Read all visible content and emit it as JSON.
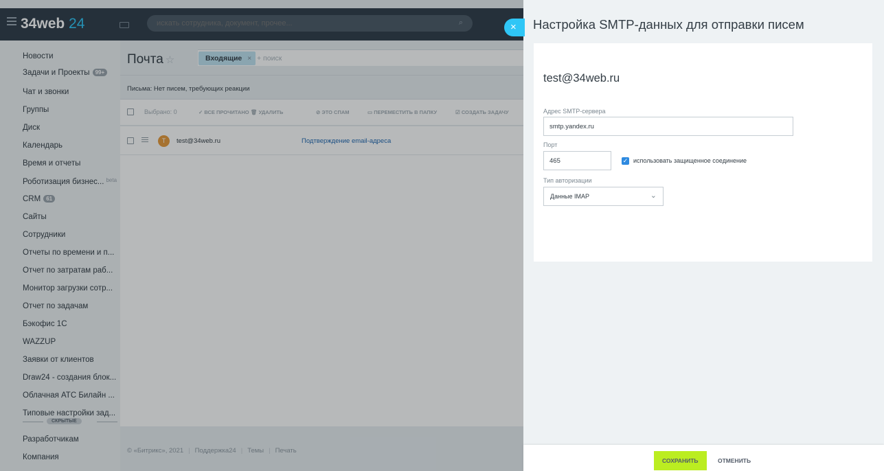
{
  "portal": {
    "logo_text": "34web",
    "logo_number": "24",
    "search_placeholder": "искать сотрудника, документ, прочее..."
  },
  "menu": {
    "items": [
      {
        "label": "Новости"
      },
      {
        "label": "Задачи и Проекты",
        "badge": "99+"
      },
      {
        "label": "Чат и звонки"
      },
      {
        "label": "Группы"
      },
      {
        "label": "Диск"
      },
      {
        "label": "Календарь"
      },
      {
        "label": "Время и отчеты"
      },
      {
        "label": "Роботизация бизнес...",
        "tag": "beta"
      },
      {
        "label": "CRM",
        "badge": "61"
      },
      {
        "label": "Сайты"
      },
      {
        "label": "Сотрудники"
      },
      {
        "label": "Отчеты по времени и п..."
      },
      {
        "label": "Отчет по затратам раб..."
      },
      {
        "label": "Монитор загрузки сотр..."
      },
      {
        "label": "Отчет по задачам"
      },
      {
        "label": "Бэкофис 1С"
      },
      {
        "label": "WAZZUP"
      },
      {
        "label": "Заявки от клиентов"
      },
      {
        "label": "Draw24 - создания блок..."
      },
      {
        "label": "Облачная АТС Билайн ..."
      },
      {
        "label": "Типовые настройки зад..."
      }
    ],
    "hidden_label": "СКРЫТЫЕ",
    "bottom_items": [
      {
        "label": "Разработчикам"
      },
      {
        "label": "Компания"
      }
    ]
  },
  "mail": {
    "title": "Почта",
    "filter_chip": "Входящие",
    "filter_search": "+ поиск",
    "letters_status": "Письма: Нет писем, требующих реакции",
    "toolbar": {
      "selected": "Выбрано: 0",
      "read_all": "ВСЕ ПРОЧИТАНО",
      "delete": "УДАЛИТЬ",
      "spam": "ЭТО СПАМ",
      "move": "ПЕРЕМЕСТИТЬ В ПАПКУ",
      "create_task": "СОЗДАТЬ ЗАДАЧУ"
    },
    "message": {
      "avatar_letter": "T",
      "from": "test@34web.ru",
      "subject": "Подтверждение email-адреса"
    }
  },
  "footer": {
    "copyright": "© «Битрикс», 2021",
    "support": "Поддержка24",
    "themes": "Темы",
    "print": "Печать"
  },
  "slider": {
    "title": "Настройка SMTP-данных для отправки писем",
    "mailbox": "test@34web.ru",
    "server_label": "Адрес SMTP-сервера",
    "server_value": "smtp.yandex.ru",
    "port_label": "Порт",
    "port_value": "465",
    "ssl_label": "использовать защищенное соединение",
    "ssl_checked": true,
    "auth_label": "Тип авторизации",
    "auth_value": "Данные IMAP",
    "save": "СОХРАНИТЬ",
    "cancel": "ОТМЕНИТЬ"
  },
  "colors": {
    "accent": "#2fc6f6",
    "save_button": "#bbed21",
    "checkbox": "#2e8ae0",
    "topbar": "#2f3c48"
  }
}
